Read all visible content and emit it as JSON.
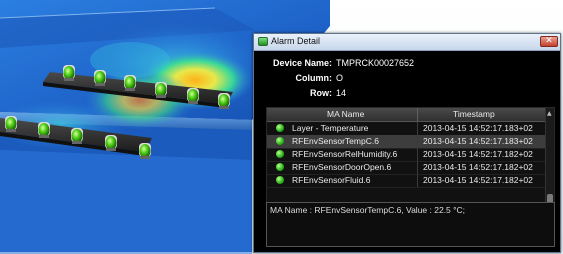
{
  "window": {
    "title": "Alarm Detail",
    "close_glyph": "✕"
  },
  "info": {
    "device_label": "Device Name:",
    "device_value": "TMPRCK00027652",
    "column_label": "Column:",
    "column_value": "O",
    "row_label": "Row:",
    "row_value": "14"
  },
  "table": {
    "headers": [
      "MA Name",
      "Timestamp"
    ],
    "rows": [
      {
        "name": "Layer - Temperature",
        "timestamp": "2013-04-15 14:52:17.183+02",
        "status_icon": "green-led-icon",
        "selected": false
      },
      {
        "name": "RFEnvSensorTempC.6",
        "timestamp": "2013-04-15 14:52:17.183+02",
        "status_icon": "green-led-icon",
        "selected": true
      },
      {
        "name": "RFEnvSensorRelHumidity.6",
        "timestamp": "2013-04-15 14:52:17.182+02",
        "status_icon": "green-led-icon",
        "selected": false
      },
      {
        "name": "RFEnvSensorDoorOpen.6",
        "timestamp": "2013-04-15 14:52:17.182+02",
        "status_icon": "green-led-icon",
        "selected": false
      },
      {
        "name": "RFEnvSensorFluid.6",
        "timestamp": "2013-04-15 14:52:17.182+02",
        "status_icon": "green-led-icon",
        "selected": false
      }
    ]
  },
  "detail_text": "MA Name : RFEnvSensorTempC.6, Value : 22.5 °C;",
  "colors": {
    "window_bg": "#000000",
    "selected_row": "#3d3d3d",
    "led_green": "#30b81e",
    "heatmap_hot": "#ff7a1a",
    "floor_blue": "#1e6fd0"
  }
}
